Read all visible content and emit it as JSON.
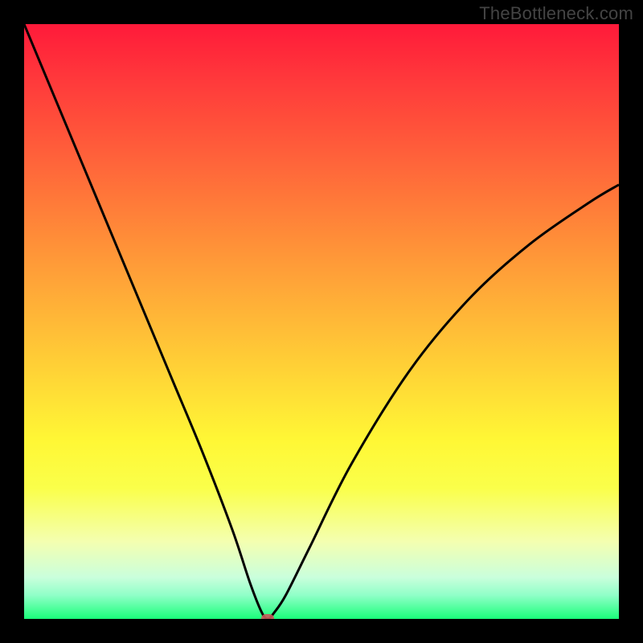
{
  "watermark": "TheBottleneck.com",
  "colors": {
    "frame_background": "#000000",
    "curve_stroke": "#000000",
    "marker_fill": "#c95a5a"
  },
  "chart_data": {
    "type": "line",
    "title": "",
    "xlabel": "",
    "ylabel": "",
    "xlim": [
      0,
      100
    ],
    "ylim": [
      0,
      100
    ],
    "series": [
      {
        "name": "bottleneck-curve",
        "x": [
          0,
          5,
          10,
          15,
          20,
          25,
          30,
          35,
          38,
          40,
          41,
          42,
          44,
          48,
          55,
          65,
          75,
          85,
          95,
          100
        ],
        "y": [
          100,
          88,
          76,
          64,
          52,
          40,
          28,
          15,
          6,
          1,
          0,
          1,
          4,
          12,
          26,
          42,
          54,
          63,
          70,
          73
        ]
      }
    ],
    "marker": {
      "x": 41,
      "y": 0
    },
    "gradient_stops": [
      {
        "pct": 0,
        "color": "#ff1a3a"
      },
      {
        "pct": 50,
        "color": "#ffd836"
      },
      {
        "pct": 80,
        "color": "#f4ffb0"
      },
      {
        "pct": 100,
        "color": "#1aff7a"
      }
    ]
  }
}
